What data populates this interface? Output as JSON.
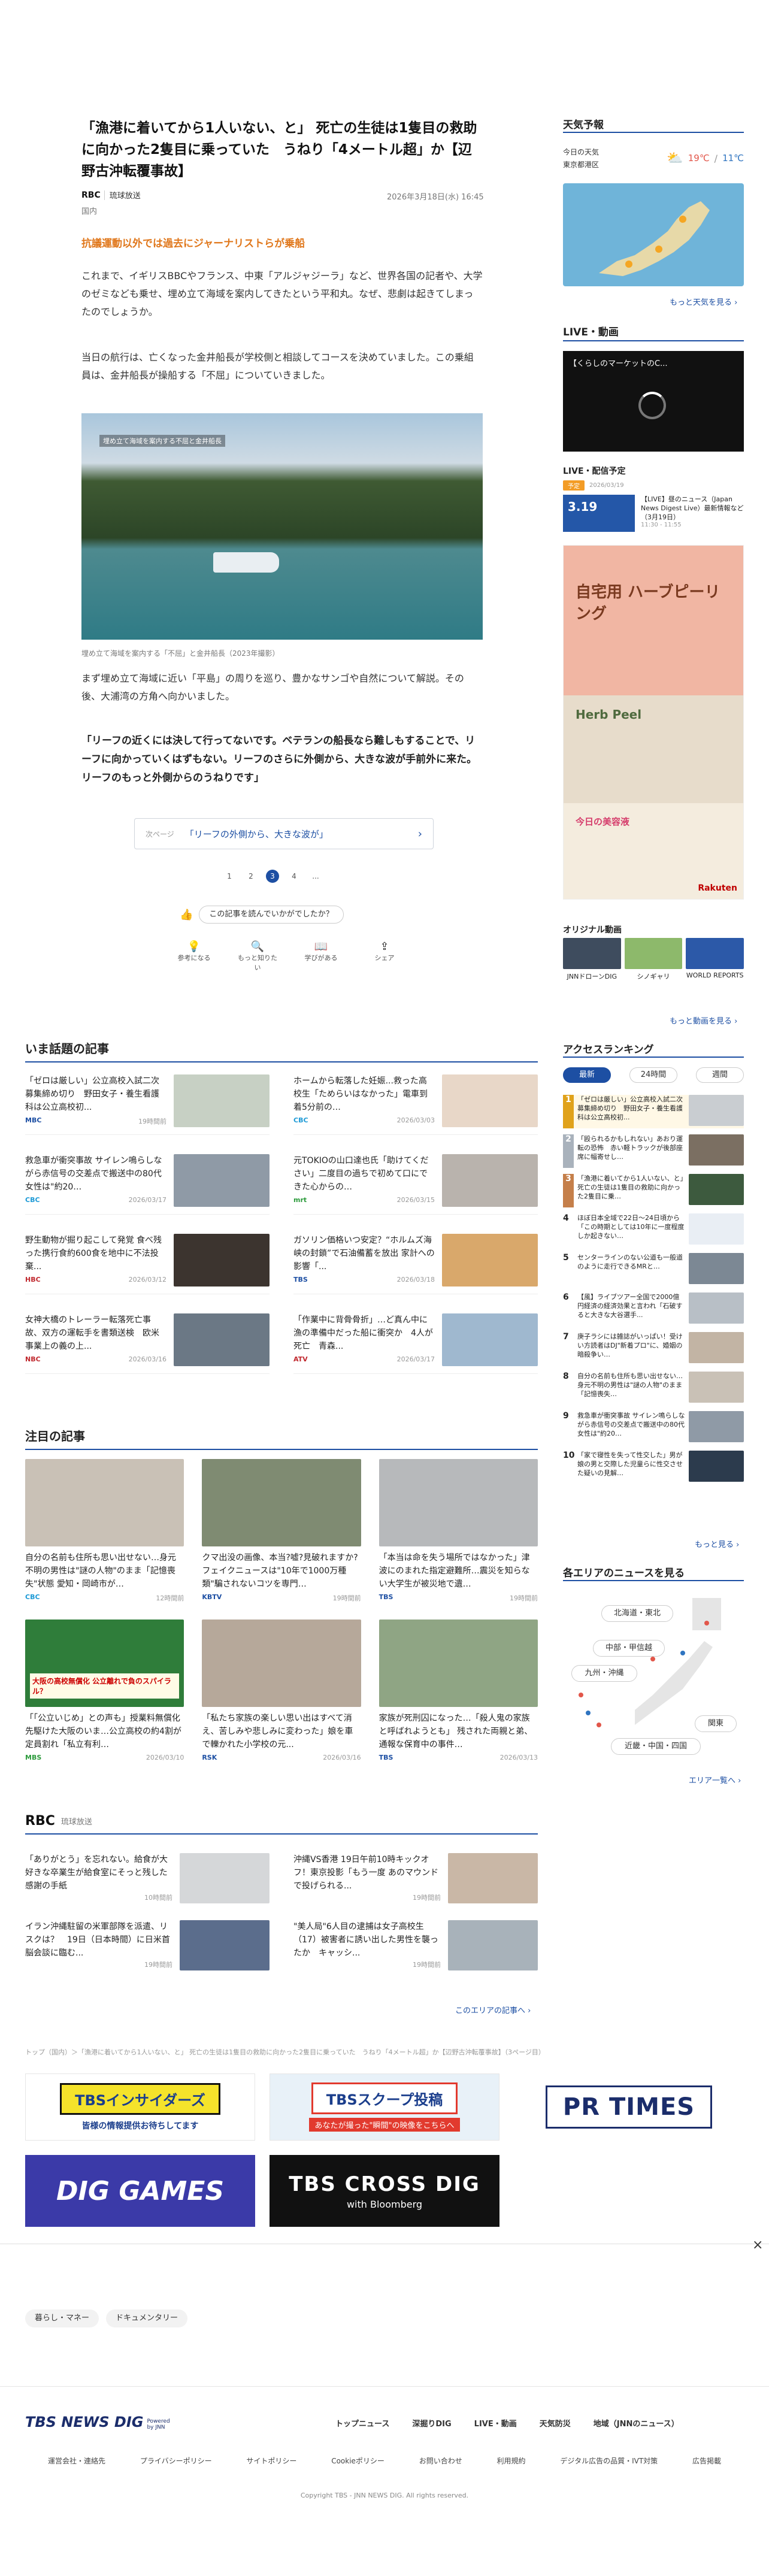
{
  "article": {
    "title": "「漁港に着いてから1人いない、と」 死亡の生徒は1隻目の救助に向かった2隻目に乗っていた　うねり「4メートル超」か【辺野古沖転覆事故】",
    "source_logo": "RBC",
    "source_name": "琉球放送",
    "date": "2026年3月18日(水) 16:45",
    "category": "国内",
    "subhead": "抗議運動以外では過去にジャーナリストらが乗船",
    "p1": "これまで、イギリスBBCやフランス、中東「アルジャジーラ」など、世界各国の記者や、大学のゼミなども乗せ、埋め立て海域を案内してきたという平和丸。なぜ、悲劇は起きてしまったのでしょうか。",
    "p2": "当日の航行は、亡くなった金井船長が学校側と相談してコースを決めていました。この乗組員は、金井船長が操船する「不屈」についていきました。",
    "image_overlay": "埋め立て海域を案内する不屈と金井船長",
    "caption": "埋め立て海域を案内する「不屈」と金井船長（2023年撮影）",
    "p3": "まず埋め立て海域に近い「平島」の周りを巡り、豊かなサンゴや自然について解説。その後、大浦湾の方角へ向かいました。",
    "quote": "「リーフの近くには決して行ってないです。ベテランの船長なら難しもすることで、リーフに向かっていくはずもない。リーフのさらに外側から、大きな波が手前外に来た。リーフのもっと外側からのうねりです」",
    "next_label": "次ページ",
    "next_title": "「リーフの外側から、大きな波が」",
    "pages": [
      "1",
      "2",
      "3",
      "4",
      "..."
    ],
    "active_page": "3",
    "feedback_question": "この記事を読んでいかがでしたか？",
    "reactions": [
      "参考になる",
      "もっと知りたい",
      "学びがある",
      "シェア"
    ]
  },
  "hot_topics": {
    "title": "いま話題の記事",
    "items": [
      {
        "text": "「ゼロは厳しい」公立高校入試二次募集締め切り　野田女子・養生看護科は公立高校初...",
        "source": "MBC",
        "time": "19時間前"
      },
      {
        "text": "ホームから転落した妊娠...救った高校生「ためらいはなかった」電車到着5分前の…",
        "source": "CBC",
        "time": "2026/03/03"
      },
      {
        "text": "救急車が衝突事故 サイレン鳴らしながら赤信号の交差点で搬送中の80代女性は\"約20…",
        "source": "CBC",
        "time": "2026/03/17"
      },
      {
        "text": "元TOKIOの山口達也氏「助けてください」二度目の過ちで初めて口にできた心からの…",
        "source": "mrt",
        "time": "2026/03/15"
      },
      {
        "text": "野生動物が掘り起こして発覚 食べ残った携行食約600食を地中に不法投棄...",
        "source": "HBC",
        "time": "2026/03/12"
      },
      {
        "text": "ガソリン価格いつ安定？“ホルムズ海峡の封鎖”で石油備蓄を放出 家計への影響「...",
        "source": "TBS",
        "time": "2026/03/18"
      },
      {
        "text": "女神大橋のトレーラー転落死亡事故、双方の運転手を書類送検　欧米事業上の義の上...",
        "source": "NBC",
        "time": "2026/03/16"
      },
      {
        "text": "「作業中に背骨骨折」…ど真ん中に 漁の準備中だった船に衝突か　4人が死亡　青森...",
        "source": "ATV",
        "time": "2026/03/17"
      }
    ]
  },
  "featured": {
    "title": "注目の記事",
    "items": [
      {
        "text": "自分の名前も住所も思い出せない…身元不明の男性は\"謎の人物\"のまま「記憶喪失\"状態 愛知・岡崎市が…",
        "source": "CBC",
        "time": "12時間前"
      },
      {
        "text": "クマ出没の画像、本当?嘘?見破れますか?フェイクニュースは\"10年で1000万種類\"騙されないコツを専門…",
        "source": "KBTV",
        "time": "19時間前"
      },
      {
        "text": "「本当は命を失う場所ではなかった」津波にのまれた指定避難所…震災を知らない大学生が被災地で遺…",
        "source": "TBS",
        "time": "19時間前"
      },
      {
        "text": "「「公立いじめ」との声も」授業料無償化先駆けた大阪のいま…公立高校の約4割が定員割れ「私立有利…",
        "source": "MBS",
        "time": "2026/03/10"
      },
      {
        "text": "「私たち家族の楽しい思い出はすべて消え、苦しみや悲しみに変わった」娘を車で轢かれた小学校の元...",
        "source": "RSK",
        "time": "2026/03/16"
      },
      {
        "text": "家族が死刑囚になった…「殺人鬼の家族と呼ばれようとも」 残された両親と弟、通報な保育中の事件…",
        "source": "TBS",
        "time": "2026/03/13"
      }
    ],
    "img_overlay": "大阪の高校無償化 公立離れで負のスパイラル？"
  },
  "rbc_section": {
    "logo": "RBC",
    "name": "琉球放送",
    "items": [
      {
        "text": "「ありがとう」を忘れない。給食が大好きな卒業生が給食室にそっと残した感謝の手紙",
        "time": "10時間前"
      },
      {
        "text": "沖縄VS香港 19日午前10時キックオフ！東京投影「もう一度 あのマウンドで投げられる...",
        "time": "19時間前"
      },
      {
        "text": "イラン沖縄駐留の米軍部隊を派遣、リスクは？　19日（日本時間）に日米首脳会談に臨む...",
        "time": "19時間前"
      },
      {
        "text": "\"美人局\"6人目の逮捕は女子高校生（17）被害者に誘い出した男性を襲ったか　キャッシ...",
        "time": "19時間前"
      }
    ],
    "more": "このエリアの記事へ ›"
  },
  "breadcrumb": "トップ（国内）＞「漁港に着いてから1人いない、と」 死亡の生徒は1隻目の救助に向かった2隻目に乗っていた　うねり「4メートル超」か【辺野古沖転覆事故】（3ページ目）",
  "banners": {
    "insider_title": "TBSインサイダーズ",
    "insider_sub": "皆様の情報提供お待ちしてます",
    "scoop_title": "TBSスクープ投稿",
    "scoop_sub": "あなたが撮った\"瞬間\"の映像をこちらへ",
    "prtimes": "PR TIMES",
    "dig_games": "DIG GAMES",
    "crossdig": "TBS CROSS DIG",
    "crossdig_sub": "with Bloomberg"
  },
  "tags": [
    "暮らし・マネー",
    "ドキュメンタリー"
  ],
  "close_icon_label": "×",
  "sidebar": {
    "weather": {
      "title": "天気予報",
      "today_label": "今日の天気",
      "place": "東京都港区",
      "hi": "19℃",
      "lo": "11℃",
      "more": "もっと天気を見る ›"
    },
    "live": {
      "title": "LIVE・動画",
      "video_title": "【くらしのマーケットのC..."
    },
    "schedule": {
      "title": "LIVE・配信予定",
      "badge": "予定",
      "date_tag": "2026/03/19",
      "thumb": "3.19",
      "text": "【LIVE】昼のニュース（Japan News Digest Live）最新情報など（3月19日）",
      "time": "11:30 - 11:55"
    },
    "ad": {
      "catch": "自宅用 ハーブピーリング",
      "product": "Herb Peel",
      "brand": "Rakuten",
      "promo": "今日の美容液"
    },
    "original": {
      "title": "オリジナル動画",
      "items": [
        "JNNドローンDIG",
        "シノギャリ",
        "WORLD REPORTS"
      ],
      "more": "もっと動画を見る ›"
    },
    "ranking": {
      "title": "アクセスランキング",
      "tabs": [
        "最新",
        "24時間",
        "週間"
      ],
      "items": [
        "「ゼロは厳しい」公立高校入試二次募集締め切り　野田女子・養生看護科は公立高校初...",
        "「殴られるかもしれない」あおり運転の恐怖　赤い軽トラックが後部座席に幅寄せし…",
        "「漁港に着いてから1人いない、と」死亡の生徒は1隻目の救助に向かった2隻目に乗…",
        "ほぼ日本全域で22日〜24日頃から「この時期としては10年に一度程度しか起きない…",
        "センターラインのない公道も一般道のように走行できるMRと…",
        "【風】ライブツアー全国で2000億円経済の経済効果と言われ「石破すると大きな大谷選手...",
        "庚子ラシには雑誌がいっぱい！受けい方読者はDJ\"新着プロ\"に、婚姻の暗殺争い…",
        "自分の名前も住所も思い出せない…身元不明の男性は\"謎の人物\"のまま「記憶喪失…",
        "救急車が衝突事故 サイレン鳴らしながら赤信号の交差点で搬送中の80代女性は\"約20…",
        "「家で寝性を失って性交した」男が娘の男と交際した児童らに性交させた疑いの見解…"
      ],
      "more": "もっと見る ›"
    },
    "area": {
      "title": "各エリアのニュースを見る",
      "regions": [
        "北海道・東北",
        "中部・甲信越",
        "九州・沖縄",
        "関東",
        "近畿・中国・四国"
      ],
      "more": "エリア一覧へ ›"
    }
  },
  "footer": {
    "logo": "TBS NEWS DIG",
    "powered": "Powered by JNN",
    "nav": [
      "トップニュース",
      "深掘りDIG",
      "LIVE・動画",
      "天気防災",
      "地域（JNNのニュース）"
    ],
    "links": [
      "運営会社・連絡先",
      "プライバシーポリシー",
      "サイトポリシー",
      "Cookieポリシー",
      "お問い合わせ",
      "利用規約",
      "デジタル広告の品質・IVT対策",
      "広告掲載"
    ],
    "copyright": "Copyright TBS - JNN NEWS DIG. All rights reserved."
  }
}
